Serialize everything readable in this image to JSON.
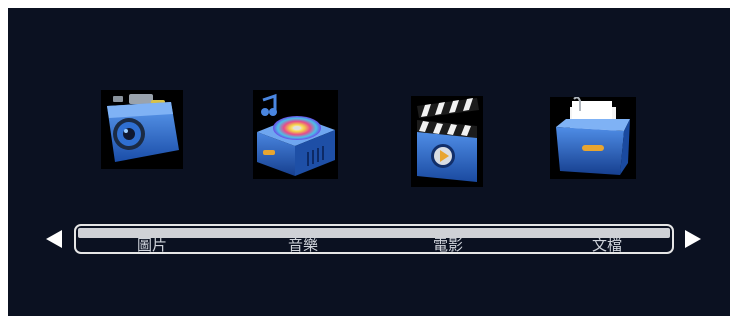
{
  "menu": {
    "items": [
      {
        "label": "圖片",
        "icon": "camera-icon"
      },
      {
        "label": "音樂",
        "icon": "music-disc-icon"
      },
      {
        "label": "電影",
        "icon": "clapperboard-icon"
      },
      {
        "label": "文檔",
        "icon": "file-folder-icon"
      }
    ]
  },
  "colors": {
    "background": "#0b1121",
    "icon_blue": "#2f6fd0",
    "highlight": "#cfd1d6",
    "text": "#cfd3da"
  }
}
